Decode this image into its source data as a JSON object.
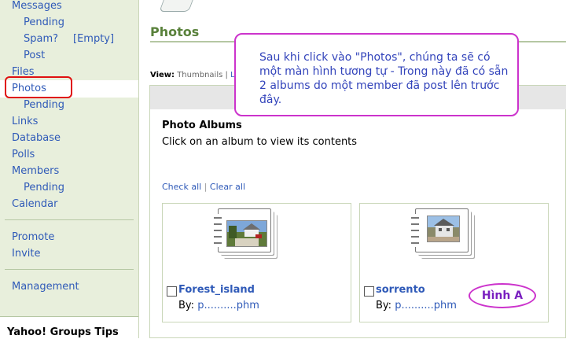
{
  "sidebar": {
    "items": [
      {
        "label": "Messages"
      },
      {
        "label": "Pending"
      },
      {
        "label": "Spam?"
      },
      {
        "label": "[Empty]"
      },
      {
        "label": "Post"
      },
      {
        "label": "Files"
      },
      {
        "label": "Photos"
      },
      {
        "label": "Pending"
      },
      {
        "label": "Links"
      },
      {
        "label": "Database"
      },
      {
        "label": "Polls"
      },
      {
        "label": "Members"
      },
      {
        "label": "Pending"
      },
      {
        "label": "Calendar"
      },
      {
        "label": "Promote"
      },
      {
        "label": "Invite"
      },
      {
        "label": "Management"
      }
    ],
    "tips_title": "Yahoo! Groups Tips"
  },
  "main": {
    "title": "Photos",
    "view_label": "View:",
    "view_thumbnails": "Thumbnails",
    "view_sep": "|",
    "view_list": "List",
    "albums_title": "Photo Albums",
    "albums_desc": "Click on an album to view its contents",
    "check_all": "Check all",
    "check_sep": "|",
    "clear_all": "Clear all",
    "albums": [
      {
        "name": "Forest_island",
        "by_label": "By:",
        "by_user": "p..........phm"
      },
      {
        "name": "sorrento",
        "by_label": "By:",
        "by_user": "p..........phm"
      }
    ]
  },
  "annotations": {
    "callout": "Sau khi click vào \"Photos\", chúng ta sẽ có một màn hình tương tự - Trong này đã có sẵn 2 albums do một member đã post lên trước đây.",
    "figure_label": "Hình A"
  },
  "colors": {
    "sidebar_bg": "#e8efdc",
    "link": "#2f5ab8",
    "title_green": "#59813b",
    "highlight_red": "#e01010",
    "callout_border": "#cc33cc"
  }
}
